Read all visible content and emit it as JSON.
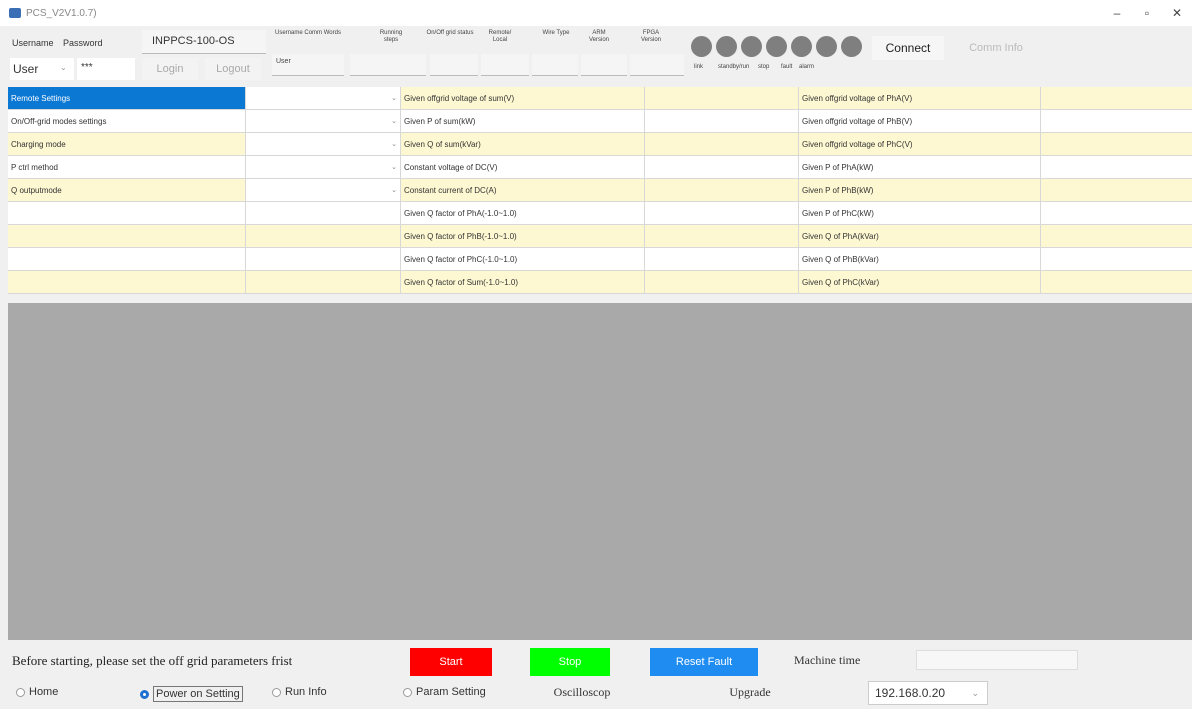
{
  "window": {
    "title": "PCS_V2V1.0.7)",
    "minimize": "–",
    "maximize": "▫",
    "close": "✕"
  },
  "header": {
    "username_label": "Username",
    "password_label": "Password",
    "device_name": "INPPCS-100-OS",
    "user_value": "User",
    "password_value": "***",
    "login_label": "Login",
    "logout_label": "Logout",
    "col_username_comm": "Username Comm Words",
    "col_user_value": "User",
    "col_running_steps": "Running steps",
    "col_onoff_status": "On/Off grid status",
    "col_remote_local": "Remote/ Local",
    "col_wire_type": "Wire Type",
    "col_arm_version": "ARM Version",
    "col_fpga_version": "FPGA Version",
    "leds": [
      "link",
      "standby/run",
      "stop",
      "fault",
      "alarm"
    ],
    "connect_label": "Connect",
    "comm_info_label": "Comm Info"
  },
  "grid": {
    "rows": [
      {
        "name": "Remote Settings",
        "mid": "Given offgrid voltage of sum(V)",
        "right": "Given offgrid voltage of PhA(V)",
        "dropdown": true
      },
      {
        "name": "On/Off-grid modes settings",
        "mid": "Given P of sum(kW)",
        "right": "Given offgrid voltage of PhB(V)",
        "dropdown": true
      },
      {
        "name": "Charging mode",
        "mid": "Given Q of sum(kVar)",
        "right": "Given offgrid voltage of PhC(V)",
        "dropdown": true
      },
      {
        "name": "P ctrl method",
        "mid": "Constant voltage of DC(V)",
        "right": "Given P of PhA(kW)",
        "dropdown": true
      },
      {
        "name": "Q outputmode",
        "mid": "Constant current of DC(A)",
        "right": "Given P of PhB(kW)",
        "dropdown": true
      },
      {
        "name": "",
        "mid": "Given Q factor of PhA(-1.0~1.0)",
        "right": "Given P of PhC(kW)",
        "dropdown": false
      },
      {
        "name": "",
        "mid": "Given Q factor of PhB(-1.0~1.0)",
        "right": "Given Q of PhA(kVar)",
        "dropdown": false
      },
      {
        "name": "",
        "mid": "Given Q factor of PhC(-1.0~1.0)",
        "right": "Given Q of PhB(kVar)",
        "dropdown": false
      },
      {
        "name": "",
        "mid": "Given Q factor of Sum(-1.0~1.0)",
        "right": "Given Q of PhC(kVar)",
        "dropdown": false
      }
    ]
  },
  "footer": {
    "notice": "Before starting, please set the off grid parameters frist",
    "start_label": "Start",
    "stop_label": "Stop",
    "reset_label": "Reset Fault",
    "machine_time_label": "Machine time",
    "machine_time_value": "",
    "nav": {
      "home": "Home",
      "power_on": "Power on Setting",
      "run_info": "Run Info",
      "param_setting": "Param Setting",
      "oscilloscope": "Oscilloscop",
      "upgrade": "Upgrade"
    },
    "ip_value": "192.168.0.20"
  },
  "colors": {
    "selection": "#0b78d4",
    "row_yellow": "#fdf8d2",
    "start": "#ff0000",
    "stop": "#00ff00",
    "reset": "#1e8cf0",
    "led": "#7f7f7f",
    "grey_area": "#a9a9a9"
  }
}
